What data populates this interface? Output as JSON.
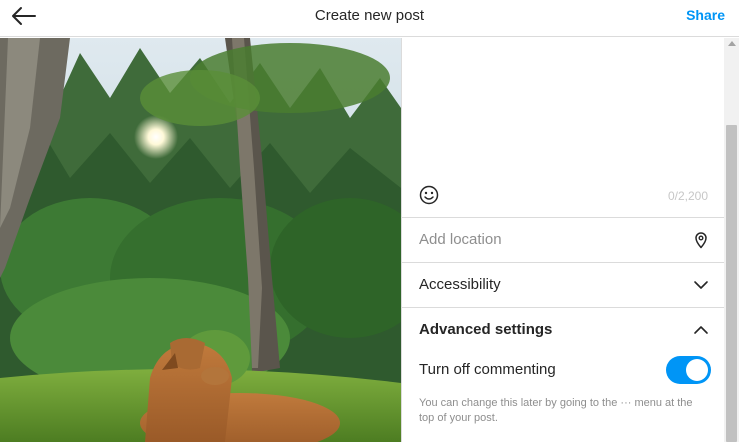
{
  "header": {
    "title": "Create new post",
    "share_label": "Share",
    "back_icon": "arrow-left-icon"
  },
  "photo": {
    "description_icon": "uploaded-photo"
  },
  "caption": {
    "placeholder": "",
    "char_count": "0/2,200",
    "emoji_icon": "smiley-icon"
  },
  "location": {
    "placeholder": "Add location",
    "icon": "location-pin-icon"
  },
  "accessibility": {
    "label": "Accessibility",
    "icon": "chevron-down-icon"
  },
  "advanced": {
    "label": "Advanced settings",
    "icon": "chevron-up-icon",
    "turn_off_commenting_label": "Turn off commenting",
    "turn_off_commenting_on": true,
    "helper_text": "You can change this later by going to the ··· menu at the top of your post."
  },
  "colors": {
    "accent": "#0095f6",
    "border": "#dbdbdb",
    "muted": "#8e8e8e"
  }
}
